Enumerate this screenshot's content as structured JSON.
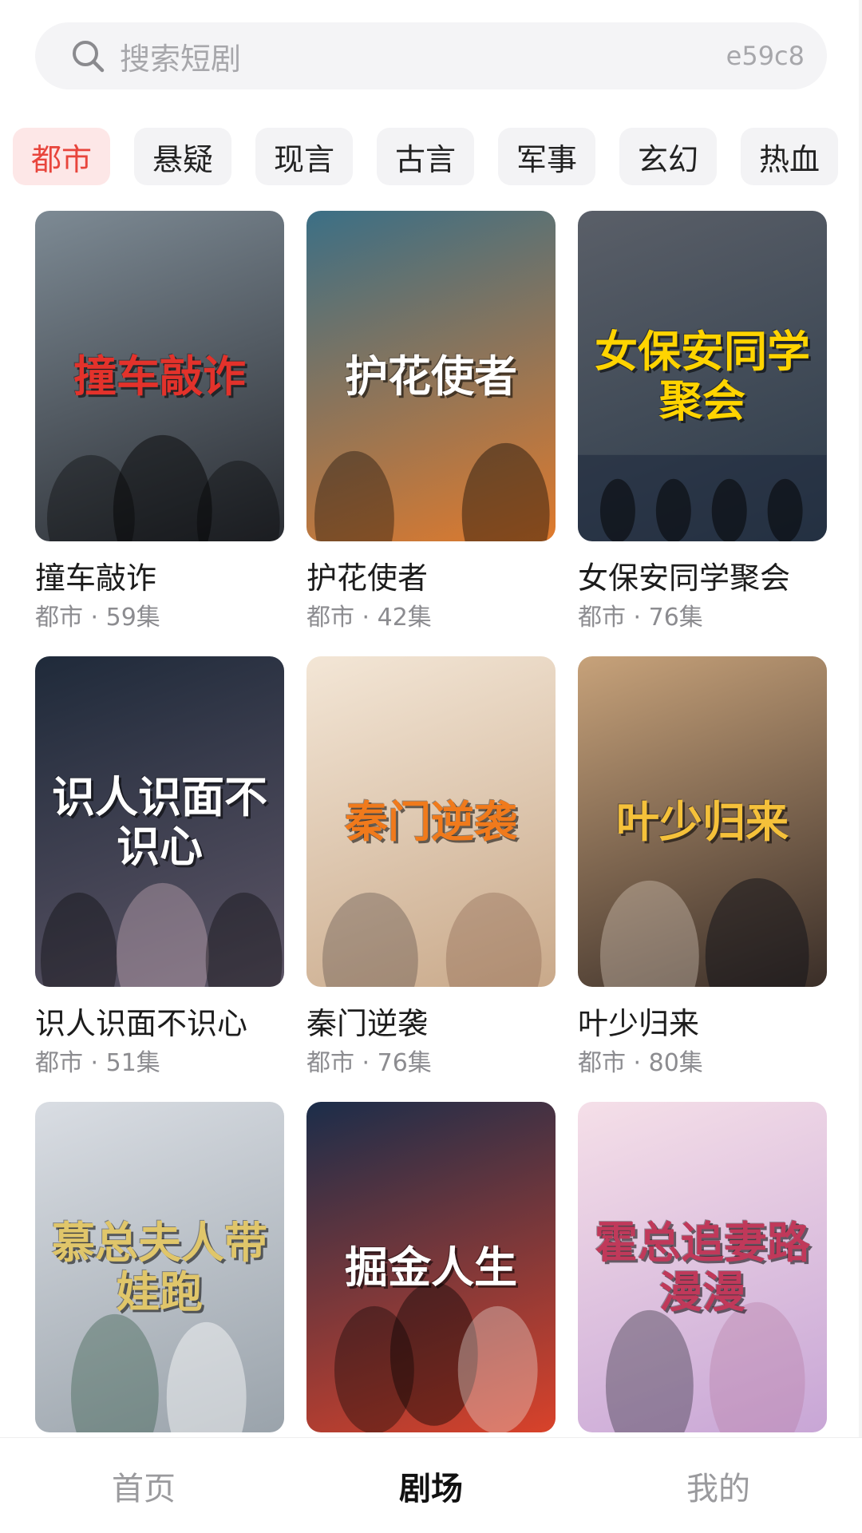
{
  "search": {
    "placeholder": "搜索短剧",
    "code": "e59c8"
  },
  "categories": [
    {
      "label": "都市",
      "active": true
    },
    {
      "label": "悬疑",
      "active": false
    },
    {
      "label": "现言",
      "active": false
    },
    {
      "label": "古言",
      "active": false
    },
    {
      "label": "军事",
      "active": false
    },
    {
      "label": "玄幻",
      "active": false
    },
    {
      "label": "热血",
      "active": false
    }
  ],
  "dramas": [
    {
      "title": "撞车敲诈",
      "meta": "都市 · 59集",
      "poster_text": "撞车敲诈",
      "colors": [
        "#7d8a94",
        "#2a2d33"
      ],
      "accent": "#e3322b"
    },
    {
      "title": "护花使者",
      "meta": "都市 · 42集",
      "poster_text": "护花使者",
      "colors": [
        "#3b6f86",
        "#e07a2c"
      ],
      "accent": "#ffffff"
    },
    {
      "title": "女保安同学聚会",
      "meta": "都市 · 76集",
      "poster_text": "女保安同学聚会",
      "colors": [
        "#5a5f68",
        "#2d3b4a"
      ],
      "accent": "#ffd400"
    },
    {
      "title": "识人识面不识心",
      "meta": "都市 · 51集",
      "poster_text": "识人识面不识心",
      "colors": [
        "#1f2a3a",
        "#5d5566"
      ],
      "accent": "#ffffff"
    },
    {
      "title": "秦门逆袭",
      "meta": "都市 · 76集",
      "poster_text": "秦门逆袭",
      "colors": [
        "#f3e6d6",
        "#c9a98a"
      ],
      "accent": "#f07a1c"
    },
    {
      "title": "叶少归来",
      "meta": "都市 · 80集",
      "poster_text": "叶少归来",
      "colors": [
        "#c7a27a",
        "#3a2e28"
      ],
      "accent": "#f5c13a"
    },
    {
      "title": "",
      "meta": "",
      "poster_text": "慕总夫人带娃跑",
      "colors": [
        "#d9dde3",
        "#9aa3ab"
      ],
      "accent": "#e0c66a"
    },
    {
      "title": "",
      "meta": "",
      "poster_text": "掘金人生",
      "colors": [
        "#1b2d4a",
        "#d9422a"
      ],
      "accent": "#ffffff"
    },
    {
      "title": "",
      "meta": "",
      "poster_text": "霍总追妻路漫漫",
      "colors": [
        "#f5dfe8",
        "#c8a6d6"
      ],
      "accent": "#c0395a"
    }
  ],
  "bottom_nav": [
    {
      "label": "首页",
      "active": false
    },
    {
      "label": "剧场",
      "active": true
    },
    {
      "label": "我的",
      "active": false
    }
  ],
  "colors": {
    "accent": "#e8453c",
    "chip_bg": "#f3f3f5",
    "chip_active_bg": "#fde7e7"
  }
}
